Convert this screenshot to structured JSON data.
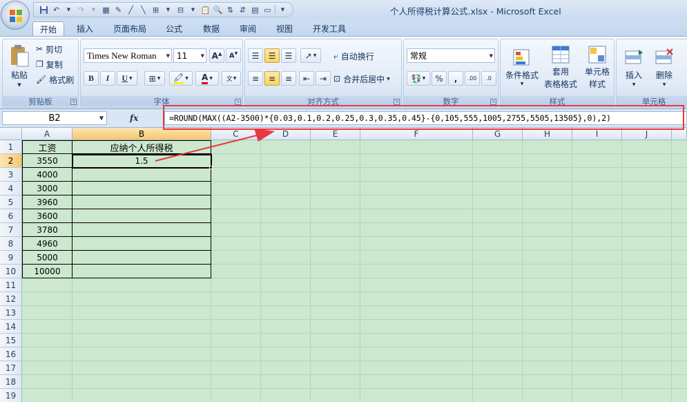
{
  "window": {
    "title": "个人所得税计算公式.xlsx - Microsoft Excel"
  },
  "ribbon_tabs": [
    "开始",
    "插入",
    "页面布局",
    "公式",
    "数据",
    "审阅",
    "视图",
    "开发工具"
  ],
  "ribbon": {
    "clipboard": {
      "paste": "粘贴",
      "cut": "剪切",
      "copy": "复制",
      "format_painter": "格式刷",
      "label": "剪贴板"
    },
    "font": {
      "font_name": "Times New Roman",
      "font_size": "11",
      "bold": "B",
      "italic": "I",
      "underline": "U",
      "phonetic": "wén",
      "label": "字体"
    },
    "alignment": {
      "wrap_text": "自动换行",
      "merge_center": "合并后居中",
      "label": "对齐方式"
    },
    "number": {
      "format": "常规",
      "percent": "%",
      "comma": ",",
      "label": "数字"
    },
    "styles": {
      "conditional": "条件格式",
      "table_format_1": "套用",
      "table_format_2": "表格格式",
      "cell_styles_1": "单元格",
      "cell_styles_2": "样式",
      "label": "样式"
    },
    "cells": {
      "insert": "插入",
      "delete": "删除",
      "label": "单元格"
    }
  },
  "formula_bar": {
    "name_box": "B2",
    "fx": "fx",
    "formula": "=ROUND(MAX((A2-3500)*{0.03,0.1,0.2,0.25,0.3,0.35,0.45}-{0,105,555,1005,2755,5505,13505},0),2)"
  },
  "columns": [
    "A",
    "B",
    "C",
    "D",
    "E",
    "F",
    "G",
    "H",
    "I",
    "J"
  ],
  "rows": [
    "1",
    "2",
    "3",
    "4",
    "5",
    "6",
    "7",
    "8",
    "9",
    "10",
    "11",
    "12",
    "13",
    "14",
    "15",
    "16",
    "17",
    "18",
    "19"
  ],
  "sheet": {
    "header_a": "工资",
    "header_b": "应纳个人所得税",
    "salaries": [
      "3550",
      "4000",
      "3000",
      "3960",
      "3600",
      "3780",
      "4960",
      "5000",
      "10000"
    ],
    "b2": "1.5"
  },
  "colors": {
    "grid_bg": "#cce8cf",
    "annotation": "#e8373f"
  }
}
